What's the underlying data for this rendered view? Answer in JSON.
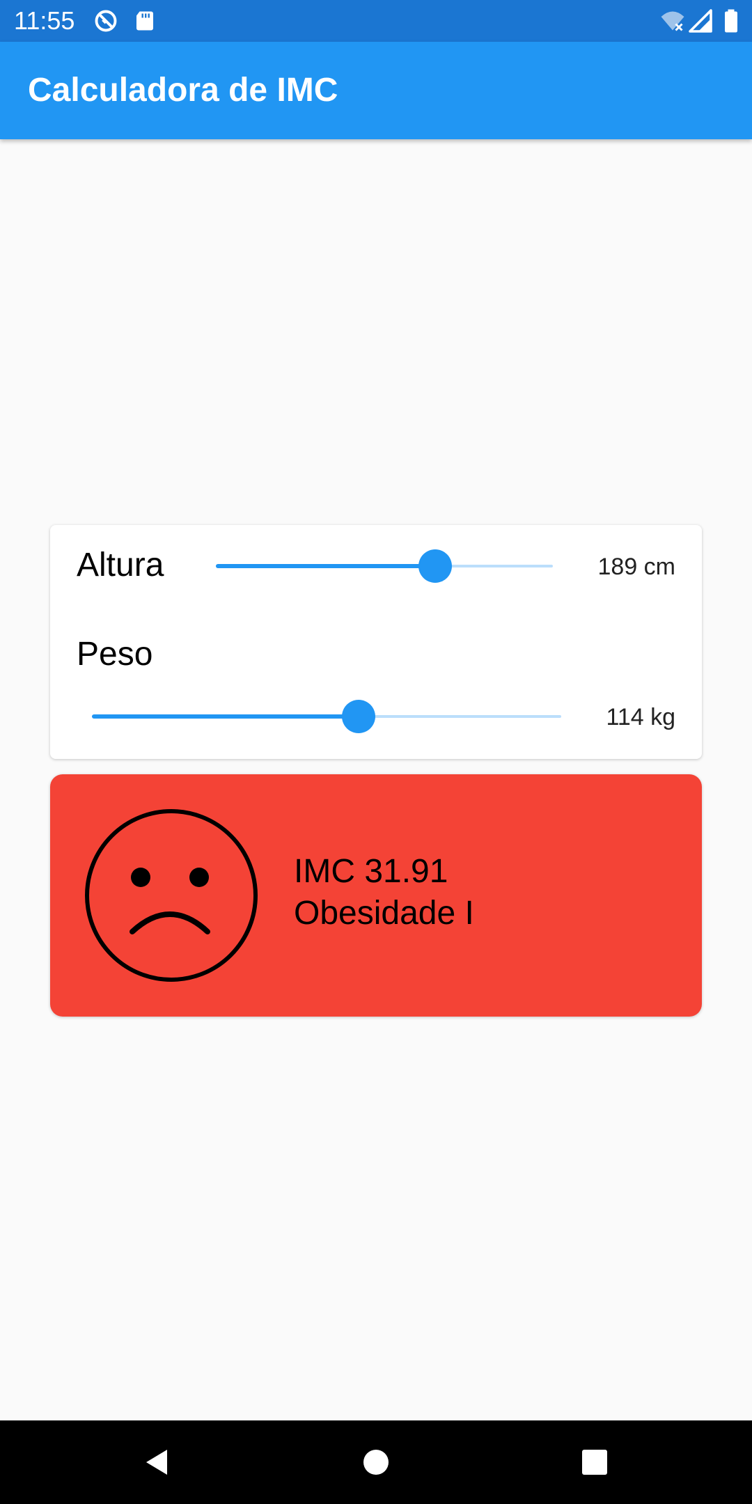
{
  "status_bar": {
    "time": "11:55",
    "icons": [
      "sync-icon",
      "sd-card-icon",
      "wifi-off-icon",
      "signal-icon",
      "battery-icon"
    ]
  },
  "app_bar": {
    "title": "Calculadora de IMC"
  },
  "form": {
    "height": {
      "label": "Altura",
      "value_text": "189 cm",
      "slider_fraction": 0.65
    },
    "weight": {
      "label": "Peso",
      "value_text": "114 kg",
      "slider_fraction": 0.568
    }
  },
  "result": {
    "imc_text": "IMC 31.91",
    "category": "Obesidade I",
    "face_icon": "sad-face-icon",
    "card_color": "#f44336"
  },
  "colors": {
    "accent": "#2196f3",
    "status_bar": "#1b76d2",
    "track_inactive": "#bbdefb"
  },
  "nav_bar": {
    "buttons": [
      "back-icon",
      "home-icon",
      "recents-icon"
    ]
  }
}
